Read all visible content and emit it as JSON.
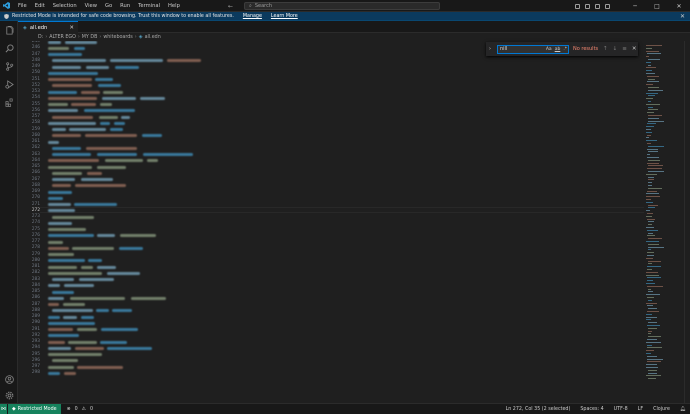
{
  "titlebar": {
    "menu": [
      "File",
      "Edit",
      "Selection",
      "View",
      "Go",
      "Run",
      "Terminal",
      "Help"
    ],
    "search_placeholder": "Search"
  },
  "banner": {
    "text": "Restricted Mode is intended for safe code browsing. Trust this window to enable all features.",
    "manage": "Manage",
    "learn_more": "Learn More"
  },
  "tab": {
    "label": "all.edn"
  },
  "breadcrumb": [
    "D:",
    "ALTER EGO",
    "MY DB",
    "whiteboards",
    "all.edn"
  ],
  "editor": {
    "line_numbers": [
      "245",
      "246",
      "247",
      "248",
      "249",
      "250",
      "251",
      "252",
      "253",
      "254",
      "255",
      "256",
      "257",
      "258",
      "259",
      "260",
      "261",
      "262",
      "263",
      "264",
      "265",
      "266",
      "267",
      "268",
      "269",
      "270",
      "271",
      "272",
      "273",
      "274",
      "275",
      "276",
      "277",
      "278",
      "279",
      "280",
      "281",
      "282",
      "283",
      "284",
      "285",
      "286",
      "287",
      "288",
      "289",
      "290",
      "291",
      "292",
      "293",
      "294",
      "295",
      "296",
      "297",
      "298"
    ],
    "current_line": "272",
    "colors": {
      "key": "#4fc1ff",
      "string": "#ce9178",
      "value": "#b5cea8",
      "text": "#9cdcfe"
    }
  },
  "find": {
    "query": "nill",
    "match_case": "Aa",
    "whole_word": "ab",
    "regex": ".*",
    "result": "No results"
  },
  "status": {
    "restricted": "Restricted Mode",
    "errors": "0",
    "warnings": "0",
    "position": "Ln 272, Col 35 (2 selected)",
    "spaces": "Spaces: 4",
    "encoding": "UTF-8",
    "eol": "LF",
    "language": "Clojure"
  }
}
